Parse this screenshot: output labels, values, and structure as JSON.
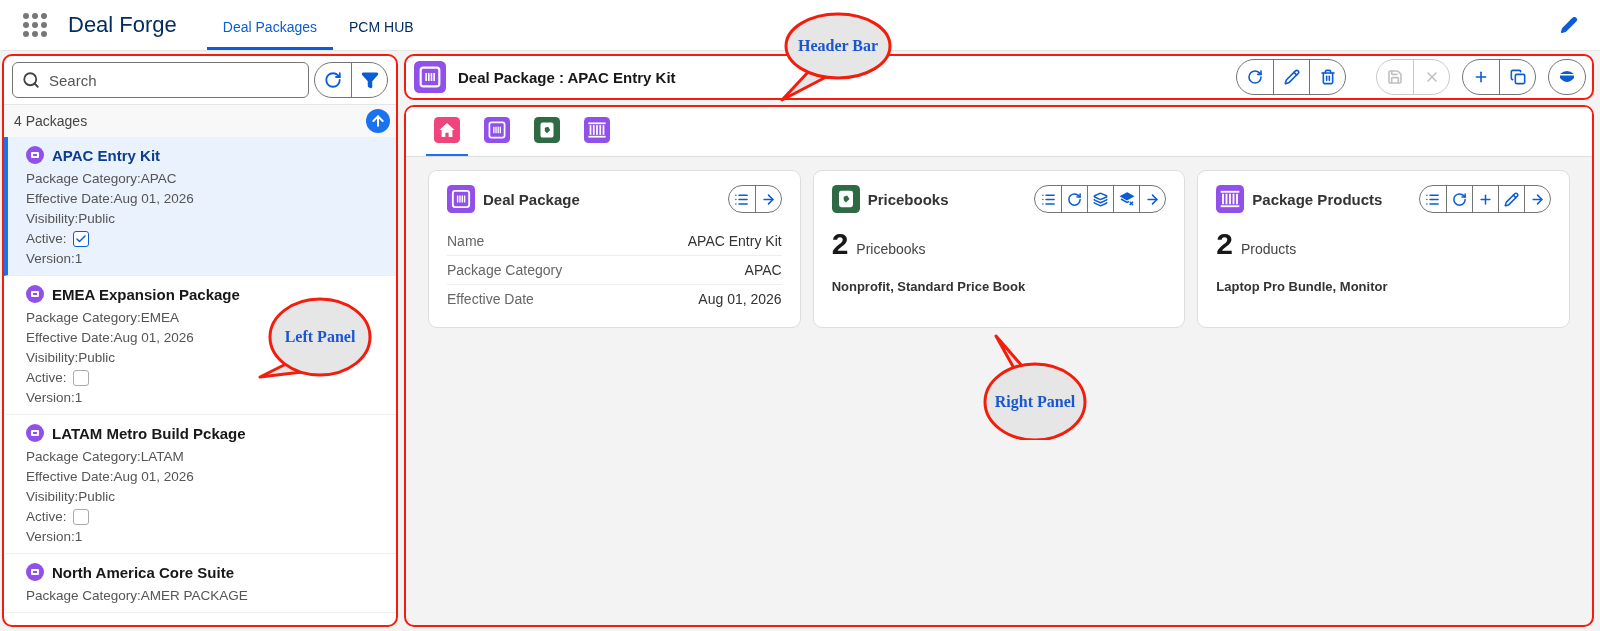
{
  "app": {
    "title": "Deal Forge"
  },
  "nav_tabs": [
    {
      "label": "Deal Packages",
      "selected": true
    },
    {
      "label": "PCM HUB",
      "selected": false
    }
  ],
  "left_panel": {
    "search": {
      "placeholder": "Search"
    },
    "count": "4 Packages",
    "packages": [
      {
        "name": "APAC Entry Kit",
        "selected": true,
        "lines": [
          {
            "kind": "text",
            "text": "Package Category:APAC"
          },
          {
            "kind": "text",
            "text": "Effective Date:Aug 01, 2026"
          },
          {
            "kind": "text",
            "text": "Visibility:Public"
          },
          {
            "kind": "checkbox",
            "text": "Active:",
            "checked": true
          },
          {
            "kind": "text",
            "text": "Version:1"
          }
        ]
      },
      {
        "name": "EMEA Expansion Package",
        "selected": false,
        "lines": [
          {
            "kind": "text",
            "text": "Package Category:EMEA"
          },
          {
            "kind": "text",
            "text": "Effective Date:Aug 01, 2026"
          },
          {
            "kind": "text",
            "text": "Visibility:Public"
          },
          {
            "kind": "checkbox",
            "text": "Active:",
            "checked": false
          },
          {
            "kind": "text",
            "text": "Version:1"
          }
        ]
      },
      {
        "name": "LATAM Metro Build Pckage",
        "selected": false,
        "lines": [
          {
            "kind": "text",
            "text": "Package Category:LATAM"
          },
          {
            "kind": "text",
            "text": "Effective Date:Aug 01, 2026"
          },
          {
            "kind": "text",
            "text": "Visibility:Public"
          },
          {
            "kind": "checkbox",
            "text": "Active:",
            "checked": false
          },
          {
            "kind": "text",
            "text": "Version:1"
          }
        ]
      },
      {
        "name": "North America Core Suite",
        "selected": false,
        "lines": [
          {
            "kind": "text",
            "text": "Package Category:AMER PACKAGE"
          }
        ]
      }
    ]
  },
  "header": {
    "title": "Deal Package : APAC Entry Kit",
    "button_groups": [
      {
        "disabled": false
      },
      {
        "disabled": true
      },
      {
        "disabled": false
      },
      {
        "disabled": false
      }
    ]
  },
  "tabs": [
    {
      "selected": true
    },
    {
      "selected": false
    },
    {
      "selected": false
    },
    {
      "selected": false
    }
  ],
  "cards": [
    {
      "kind": "fields",
      "title": "Deal Package",
      "rows": [
        {
          "label": "Name",
          "value": "APAC Entry Kit"
        },
        {
          "label": "Package Category",
          "value": "APAC"
        },
        {
          "label": "Effective Date",
          "value": "Aug 01, 2026"
        }
      ]
    },
    {
      "kind": "count",
      "title": "Pricebooks",
      "count": "2",
      "unit": "Pricebooks",
      "summary": "Nonprofit, Standard Price Book"
    },
    {
      "kind": "count",
      "title": "Package Products",
      "count": "2",
      "unit": "Products",
      "summary": "Laptop Pro Bundle, Monitor"
    }
  ],
  "callouts": [
    {
      "text": "Header Bar"
    },
    {
      "text": "Left Panel"
    },
    {
      "text": "Right Panel"
    }
  ]
}
